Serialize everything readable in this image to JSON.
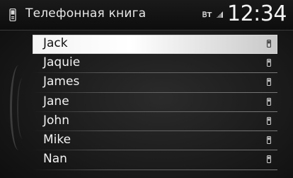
{
  "header": {
    "title": "Телефонная книга",
    "status_icon": "bluetooth-status-icon",
    "phone_icon": "phone-icon",
    "clock": "12:34"
  },
  "contacts": {
    "items": [
      {
        "name": "Jack",
        "icon": "phone-number-icon",
        "selected": true
      },
      {
        "name": "Jaquie",
        "icon": "phone-number-icon",
        "selected": false
      },
      {
        "name": "James",
        "icon": "phone-number-icon",
        "selected": false
      },
      {
        "name": "Jane",
        "icon": "phone-number-icon",
        "selected": false
      },
      {
        "name": "John",
        "icon": "phone-number-icon",
        "selected": false
      },
      {
        "name": "Mike",
        "icon": "phone-number-icon",
        "selected": false
      },
      {
        "name": "Nan",
        "icon": "phone-number-icon",
        "selected": false
      }
    ]
  },
  "colors": {
    "background": "#1a1a1a",
    "text": "#f2f2f2",
    "selection": "#ffffff"
  }
}
